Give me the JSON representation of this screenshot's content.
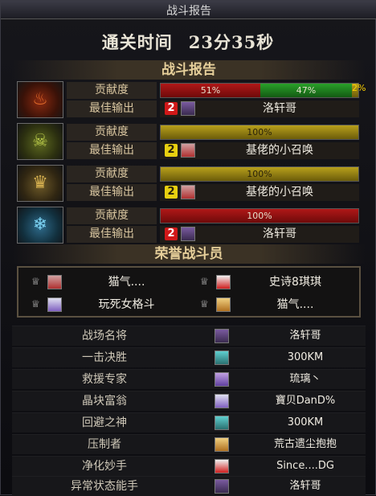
{
  "window": {
    "title": "战斗报告"
  },
  "clear_time": {
    "label": "通关时间",
    "value": "23分35秒"
  },
  "sections": {
    "battle_report": "战斗报告",
    "honor": "荣誉战斗员"
  },
  "reports": [
    {
      "contribution_label": "贡献度",
      "best_label": "最佳输出",
      "rank": "2",
      "best_name": "洛轩哥",
      "segments": [
        {
          "color": "red",
          "pct": 51,
          "text": "51%"
        },
        {
          "color": "green",
          "pct": 47,
          "text": "47%"
        },
        {
          "color": "yellow",
          "pct": 2,
          "text": "2%"
        }
      ]
    },
    {
      "contribution_label": "贡献度",
      "best_label": "最佳输出",
      "rank": "2",
      "best_name": "基佬的小召唤",
      "segments": [
        {
          "color": "yellow",
          "pct": 100,
          "text": "100%"
        }
      ]
    },
    {
      "contribution_label": "贡献度",
      "best_label": "最佳输出",
      "rank": "2",
      "best_name": "基佬的小召唤",
      "segments": [
        {
          "color": "yellow",
          "pct": 100,
          "text": "100%"
        }
      ]
    },
    {
      "contribution_label": "贡献度",
      "best_label": "最佳输出",
      "rank": "2",
      "best_name": "洛轩哥",
      "segments": [
        {
          "color": "red",
          "pct": 100,
          "text": "100%"
        }
      ]
    }
  ],
  "honor_members": [
    "猫气....",
    "史诗8琪琪",
    "玩死女格斗",
    "猫气...."
  ],
  "titles": [
    {
      "title": "战场名将",
      "name": "洛轩哥"
    },
    {
      "title": "一击决胜",
      "name": "300KM"
    },
    {
      "title": "救援专家",
      "name": "琉璃丶"
    },
    {
      "title": "晶块富翁",
      "name": "寶贝DanD%"
    },
    {
      "title": "回避之神",
      "name": "300KM"
    },
    {
      "title": "压制者",
      "name": "荒古遗尘抱抱"
    },
    {
      "title": "净化妙手",
      "name": "Since....DG"
    },
    {
      "title": "异常状态能手",
      "name": "洛轩哥"
    }
  ],
  "colors": {
    "accent_gold": "#e6cf9a",
    "bar_red": "#b01818",
    "bar_green": "#2aa02a",
    "bar_yellow": "#b8a01c"
  }
}
